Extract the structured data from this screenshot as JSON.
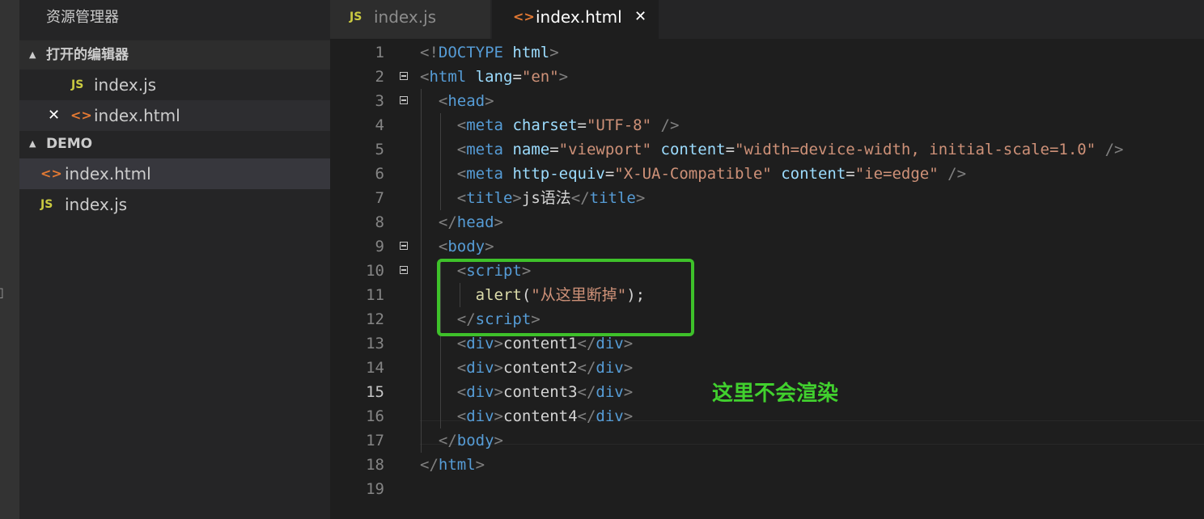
{
  "explorer": {
    "title": "资源管理器",
    "open_editors_label": "打开的编辑器",
    "open_editors": [
      {
        "icon": "JS",
        "name": "index.js"
      },
      {
        "icon": "<>",
        "name": "index.html",
        "close": "✕"
      }
    ],
    "folder_label": "DEMO",
    "files": [
      {
        "icon": "<>",
        "name": "index.html"
      },
      {
        "icon": "JS",
        "name": "index.js"
      }
    ]
  },
  "tabs": [
    {
      "icon": "JS",
      "label": "index.js"
    },
    {
      "icon": "<>",
      "label": "index.html",
      "close": "✕"
    }
  ],
  "editor": {
    "current_line": 15,
    "lines": [
      [
        [
          "t-punc",
          "<!"
        ],
        [
          "t-tag",
          "DOCTYPE"
        ],
        [
          "t-text",
          " "
        ],
        [
          "t-attr",
          "html"
        ],
        [
          "t-punc",
          ">"
        ]
      ],
      [
        [
          "t-punc",
          "<"
        ],
        [
          "t-tag",
          "html"
        ],
        [
          "t-text",
          " "
        ],
        [
          "t-attr",
          "lang"
        ],
        [
          "t-text",
          "="
        ],
        [
          "t-str",
          "\"en\""
        ],
        [
          "t-punc",
          ">"
        ]
      ],
      [
        [
          "t-text",
          "  "
        ],
        [
          "t-punc",
          "<"
        ],
        [
          "t-tag",
          "head"
        ],
        [
          "t-punc",
          ">"
        ]
      ],
      [
        [
          "t-text",
          "    "
        ],
        [
          "t-punc",
          "<"
        ],
        [
          "t-tag",
          "meta"
        ],
        [
          "t-text",
          " "
        ],
        [
          "t-attr",
          "charset"
        ],
        [
          "t-text",
          "="
        ],
        [
          "t-str",
          "\"UTF-8\""
        ],
        [
          "t-text",
          " "
        ],
        [
          "t-punc",
          "/>"
        ]
      ],
      [
        [
          "t-text",
          "    "
        ],
        [
          "t-punc",
          "<"
        ],
        [
          "t-tag",
          "meta"
        ],
        [
          "t-text",
          " "
        ],
        [
          "t-attr",
          "name"
        ],
        [
          "t-text",
          "="
        ],
        [
          "t-str",
          "\"viewport\""
        ],
        [
          "t-text",
          " "
        ],
        [
          "t-attr",
          "content"
        ],
        [
          "t-text",
          "="
        ],
        [
          "t-str",
          "\"width=device-width, initial-scale=1.0\""
        ],
        [
          "t-text",
          " "
        ],
        [
          "t-punc",
          "/>"
        ]
      ],
      [
        [
          "t-text",
          "    "
        ],
        [
          "t-punc",
          "<"
        ],
        [
          "t-tag",
          "meta"
        ],
        [
          "t-text",
          " "
        ],
        [
          "t-attr",
          "http-equiv"
        ],
        [
          "t-text",
          "="
        ],
        [
          "t-str",
          "\"X-UA-Compatible\""
        ],
        [
          "t-text",
          " "
        ],
        [
          "t-attr",
          "content"
        ],
        [
          "t-text",
          "="
        ],
        [
          "t-str",
          "\"ie=edge\""
        ],
        [
          "t-text",
          " "
        ],
        [
          "t-punc",
          "/>"
        ]
      ],
      [
        [
          "t-text",
          "    "
        ],
        [
          "t-punc",
          "<"
        ],
        [
          "t-tag",
          "title"
        ],
        [
          "t-punc",
          ">"
        ],
        [
          "t-text",
          "js语法"
        ],
        [
          "t-punc",
          "</"
        ],
        [
          "t-tag",
          "title"
        ],
        [
          "t-punc",
          ">"
        ]
      ],
      [
        [
          "t-text",
          "  "
        ],
        [
          "t-punc",
          "</"
        ],
        [
          "t-tag",
          "head"
        ],
        [
          "t-punc",
          ">"
        ]
      ],
      [
        [
          "t-text",
          "  "
        ],
        [
          "t-punc",
          "<"
        ],
        [
          "t-tag",
          "body"
        ],
        [
          "t-punc",
          ">"
        ]
      ],
      [
        [
          "t-text",
          "    "
        ],
        [
          "t-punc",
          "<"
        ],
        [
          "t-tag",
          "script"
        ],
        [
          "t-punc",
          ">"
        ]
      ],
      [
        [
          "t-text",
          "      "
        ],
        [
          "t-fn",
          "alert"
        ],
        [
          "t-text",
          "("
        ],
        [
          "t-str",
          "\"从这里断掉\""
        ],
        [
          "t-text",
          ");"
        ]
      ],
      [
        [
          "t-text",
          "    "
        ],
        [
          "t-punc",
          "</"
        ],
        [
          "t-tag",
          "script"
        ],
        [
          "t-punc",
          ">"
        ]
      ],
      [
        [
          "t-text",
          "    "
        ],
        [
          "t-punc",
          "<"
        ],
        [
          "t-tag",
          "div"
        ],
        [
          "t-punc",
          ">"
        ],
        [
          "t-text",
          "content1"
        ],
        [
          "t-punc",
          "</"
        ],
        [
          "t-tag",
          "div"
        ],
        [
          "t-punc",
          ">"
        ]
      ],
      [
        [
          "t-text",
          "    "
        ],
        [
          "t-punc",
          "<"
        ],
        [
          "t-tag",
          "div"
        ],
        [
          "t-punc",
          ">"
        ],
        [
          "t-text",
          "content2"
        ],
        [
          "t-punc",
          "</"
        ],
        [
          "t-tag",
          "div"
        ],
        [
          "t-punc",
          ">"
        ]
      ],
      [
        [
          "t-text",
          "    "
        ],
        [
          "t-punc",
          "<"
        ],
        [
          "t-tag",
          "div"
        ],
        [
          "t-punc",
          ">"
        ],
        [
          "t-text",
          "content3"
        ],
        [
          "t-punc",
          "</"
        ],
        [
          "t-tag",
          "div"
        ],
        [
          "t-punc",
          ">"
        ]
      ],
      [
        [
          "t-text",
          "    "
        ],
        [
          "t-punc",
          "<"
        ],
        [
          "t-tag",
          "div"
        ],
        [
          "t-punc",
          ">"
        ],
        [
          "t-text",
          "content4"
        ],
        [
          "t-punc",
          "</"
        ],
        [
          "t-tag",
          "div"
        ],
        [
          "t-punc",
          ">"
        ]
      ],
      [
        [
          "t-text",
          "  "
        ],
        [
          "t-punc",
          "</"
        ],
        [
          "t-tag",
          "body"
        ],
        [
          "t-punc",
          ">"
        ]
      ],
      [
        [
          "t-punc",
          "</"
        ],
        [
          "t-tag",
          "html"
        ],
        [
          "t-punc",
          ">"
        ]
      ],
      []
    ],
    "foldable_lines": [
      2,
      3,
      9,
      10
    ]
  },
  "annotation": {
    "text": "这里不会渲染",
    "color": "#3ec12a"
  }
}
